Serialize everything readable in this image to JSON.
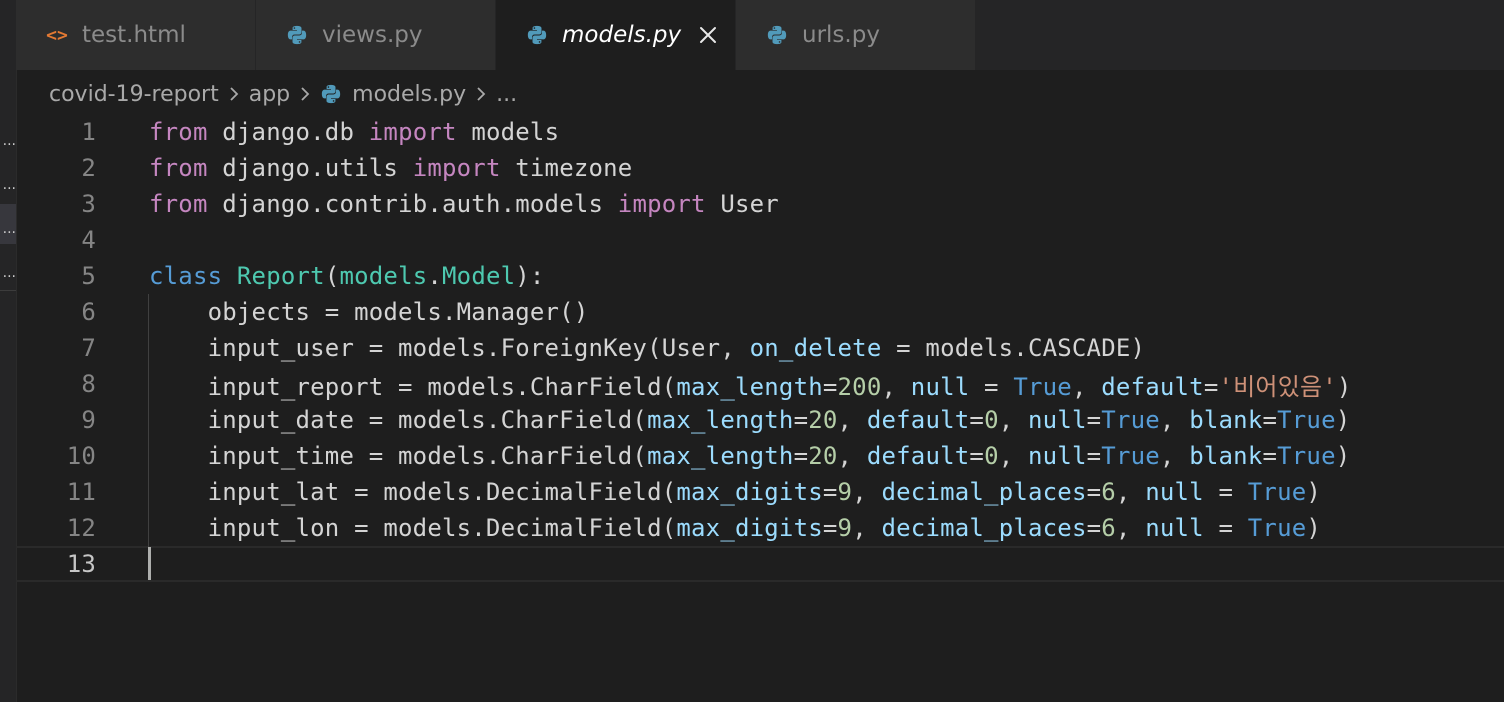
{
  "tabs": [
    {
      "label": "test.html",
      "icon": "html-brackets-icon",
      "active": false
    },
    {
      "label": "views.py",
      "icon": "python-icon",
      "active": false
    },
    {
      "label": "models.py",
      "icon": "python-icon",
      "active": true
    },
    {
      "label": "urls.py",
      "icon": "python-icon",
      "active": false
    }
  ],
  "breadcrumb": {
    "project": "covid-19-report",
    "folder": "app",
    "file": "models.py",
    "more": "..."
  },
  "sidebar_ellipsis": [
    "...",
    "...",
    "...",
    "..."
  ],
  "editor": {
    "current_line": 13,
    "lines": [
      {
        "num": "1",
        "tokens": [
          [
            "k-pink",
            "from"
          ],
          [
            "t-plain",
            " django.db "
          ],
          [
            "k-pink",
            "import"
          ],
          [
            "t-plain",
            " models"
          ]
        ]
      },
      {
        "num": "2",
        "tokens": [
          [
            "k-pink",
            "from"
          ],
          [
            "t-plain",
            " django.utils "
          ],
          [
            "k-pink",
            "import"
          ],
          [
            "t-plain",
            " timezone"
          ]
        ]
      },
      {
        "num": "3",
        "tokens": [
          [
            "k-pink",
            "from"
          ],
          [
            "t-plain",
            " django.contrib.auth.models "
          ],
          [
            "k-pink",
            "import"
          ],
          [
            "t-plain",
            " User"
          ]
        ]
      },
      {
        "num": "4",
        "tokens": []
      },
      {
        "num": "5",
        "tokens": [
          [
            "k-blue",
            "class"
          ],
          [
            "t-plain",
            " "
          ],
          [
            "t-teal",
            "Report"
          ],
          [
            "t-plain",
            "("
          ],
          [
            "t-teal",
            "models"
          ],
          [
            "t-plain",
            "."
          ],
          [
            "t-teal",
            "Model"
          ],
          [
            "t-plain",
            "):"
          ]
        ]
      },
      {
        "num": "6",
        "tokens": [
          [
            "t-plain",
            "    objects = models.Manager()"
          ]
        ]
      },
      {
        "num": "7",
        "tokens": [
          [
            "t-plain",
            "    input_user = models.ForeignKey(User, "
          ],
          [
            "t-lblue",
            "on_delete"
          ],
          [
            "t-plain",
            " = models.CASCADE)"
          ]
        ]
      },
      {
        "num": "8",
        "tokens": [
          [
            "t-plain",
            "    input_report = models.CharField("
          ],
          [
            "t-lblue",
            "max_length"
          ],
          [
            "t-plain",
            "="
          ],
          [
            "t-num",
            "200"
          ],
          [
            "t-plain",
            ", "
          ],
          [
            "t-lblue",
            "null"
          ],
          [
            "t-plain",
            " = "
          ],
          [
            "k-blue",
            "True"
          ],
          [
            "t-plain",
            ", "
          ],
          [
            "t-lblue",
            "default"
          ],
          [
            "t-plain",
            "="
          ],
          [
            "t-str",
            "'비어있음'"
          ],
          [
            "t-plain",
            ")"
          ]
        ]
      },
      {
        "num": "9",
        "tokens": [
          [
            "t-plain",
            "    input_date = models.CharField("
          ],
          [
            "t-lblue",
            "max_length"
          ],
          [
            "t-plain",
            "="
          ],
          [
            "t-num",
            "20"
          ],
          [
            "t-plain",
            ", "
          ],
          [
            "t-lblue",
            "default"
          ],
          [
            "t-plain",
            "="
          ],
          [
            "t-num",
            "0"
          ],
          [
            "t-plain",
            ", "
          ],
          [
            "t-lblue",
            "null"
          ],
          [
            "t-plain",
            "="
          ],
          [
            "k-blue",
            "True"
          ],
          [
            "t-plain",
            ", "
          ],
          [
            "t-lblue",
            "blank"
          ],
          [
            "t-plain",
            "="
          ],
          [
            "k-blue",
            "True"
          ],
          [
            "t-plain",
            ")"
          ]
        ]
      },
      {
        "num": "10",
        "tokens": [
          [
            "t-plain",
            "    input_time = models.CharField("
          ],
          [
            "t-lblue",
            "max_length"
          ],
          [
            "t-plain",
            "="
          ],
          [
            "t-num",
            "20"
          ],
          [
            "t-plain",
            ", "
          ],
          [
            "t-lblue",
            "default"
          ],
          [
            "t-plain",
            "="
          ],
          [
            "t-num",
            "0"
          ],
          [
            "t-plain",
            ", "
          ],
          [
            "t-lblue",
            "null"
          ],
          [
            "t-plain",
            "="
          ],
          [
            "k-blue",
            "True"
          ],
          [
            "t-plain",
            ", "
          ],
          [
            "t-lblue",
            "blank"
          ],
          [
            "t-plain",
            "="
          ],
          [
            "k-blue",
            "True"
          ],
          [
            "t-plain",
            ")"
          ]
        ]
      },
      {
        "num": "11",
        "tokens": [
          [
            "t-plain",
            "    input_lat = models.DecimalField("
          ],
          [
            "t-lblue",
            "max_digits"
          ],
          [
            "t-plain",
            "="
          ],
          [
            "t-num",
            "9"
          ],
          [
            "t-plain",
            ", "
          ],
          [
            "t-lblue",
            "decimal_places"
          ],
          [
            "t-plain",
            "="
          ],
          [
            "t-num",
            "6"
          ],
          [
            "t-plain",
            ", "
          ],
          [
            "t-lblue",
            "null"
          ],
          [
            "t-plain",
            " = "
          ],
          [
            "k-blue",
            "True"
          ],
          [
            "t-plain",
            ")"
          ]
        ]
      },
      {
        "num": "12",
        "tokens": [
          [
            "t-plain",
            "    input_lon = models.DecimalField("
          ],
          [
            "t-lblue",
            "max_digits"
          ],
          [
            "t-plain",
            "="
          ],
          [
            "t-num",
            "9"
          ],
          [
            "t-plain",
            ", "
          ],
          [
            "t-lblue",
            "decimal_places"
          ],
          [
            "t-plain",
            "="
          ],
          [
            "t-num",
            "6"
          ],
          [
            "t-plain",
            ", "
          ],
          [
            "t-lblue",
            "null"
          ],
          [
            "t-plain",
            " = "
          ],
          [
            "k-blue",
            "True"
          ],
          [
            "t-plain",
            ")"
          ]
        ]
      },
      {
        "num": "13",
        "tokens": []
      }
    ]
  },
  "colors": {
    "editor_bg": "#1e1e1e",
    "tabbar_bg": "#252526",
    "keyword_pink": "#c586c0",
    "keyword_blue": "#569cd6",
    "type_teal": "#4ec9b0",
    "param_lightblue": "#9cdcfe",
    "number_green": "#b5cea8",
    "string_orange": "#ce9178",
    "python_icon_blue": "#519aba",
    "html_icon_orange": "#e37933"
  }
}
